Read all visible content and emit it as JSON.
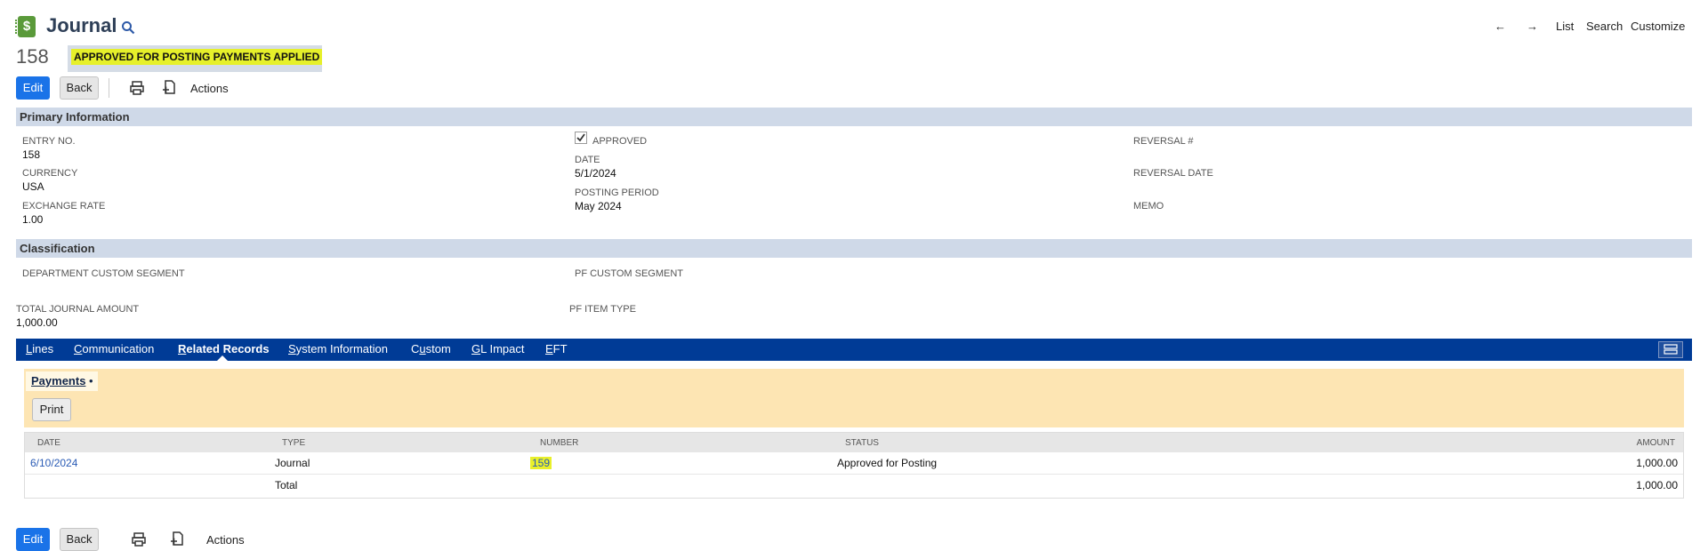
{
  "header": {
    "title": "Journal",
    "record_number": "158",
    "status": "APPROVED FOR POSTING PAYMENTS APPLIED",
    "nav": {
      "back_arrow": "←",
      "forward_arrow": "→",
      "list": "List",
      "search": "Search",
      "customize": "Customize"
    }
  },
  "toolbar": {
    "edit": "Edit",
    "back": "Back",
    "actions": "Actions"
  },
  "primary_information": {
    "title": "Primary Information",
    "entry_no_label": "ENTRY NO.",
    "entry_no": "158",
    "currency_label": "CURRENCY",
    "currency": "USA",
    "exchange_rate_label": "EXCHANGE RATE",
    "exchange_rate": "1.00",
    "approved_label": "APPROVED",
    "approved": true,
    "date_label": "DATE",
    "date": "5/1/2024",
    "posting_period_label": "POSTING PERIOD",
    "posting_period": "May 2024",
    "reversal_no_label": "REVERSAL #",
    "reversal_date_label": "REVERSAL DATE",
    "memo_label": "MEMO"
  },
  "classification": {
    "title": "Classification",
    "department_label": "DEPARTMENT CUSTOM SEGMENT",
    "pf_segment_label": "PF CUSTOM SEGMENT",
    "total_label": "TOTAL JOURNAL AMOUNT",
    "total": "1,000.00",
    "pf_item_type_label": "PF ITEM TYPE"
  },
  "tabs": [
    {
      "label": "Lines",
      "accesskey": "L"
    },
    {
      "label": "Communication",
      "accesskey": "C"
    },
    {
      "label": "Related Records",
      "accesskey": "R",
      "active": true
    },
    {
      "label": "System Information",
      "accesskey": "S"
    },
    {
      "label": "Custom",
      "accesskey": "u"
    },
    {
      "label": "GL Impact",
      "accesskey": "G"
    },
    {
      "label": "EFT",
      "accesskey": "E"
    }
  ],
  "sublist": {
    "tab_label": "Payments",
    "tab_marker": "•",
    "print_label": "Print",
    "columns": [
      "DATE",
      "TYPE",
      "NUMBER",
      "STATUS",
      "AMOUNT"
    ],
    "rows": [
      {
        "date": "6/10/2024",
        "type": "Journal",
        "number": "159",
        "status": "Approved for Posting",
        "amount": "1,000.00"
      }
    ],
    "total_label": "Total",
    "total_amount": "1,000.00"
  },
  "colors": {
    "accent": "#1a73e8",
    "tabbar": "#003b96",
    "section": "#cfd9e8",
    "sublist_panel": "#fde5b3",
    "highlight": "#e9f02a"
  },
  "icons": [
    "journal-record-icon",
    "search-icon",
    "print-icon",
    "new-document-icon",
    "tab-menu-icon",
    "checkmark-icon"
  ]
}
